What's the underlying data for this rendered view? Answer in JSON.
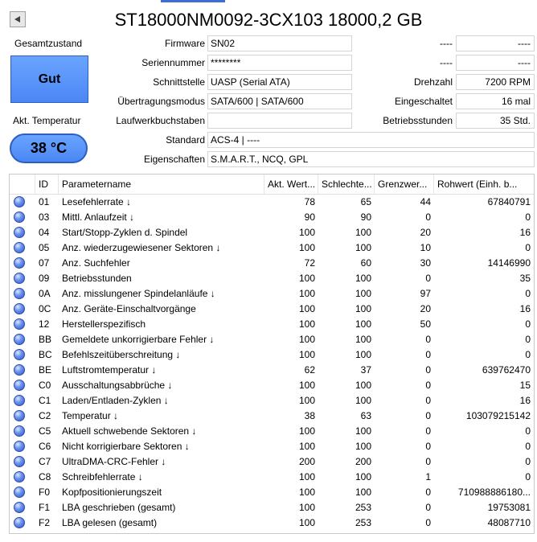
{
  "title": "ST18000NM0092-3CX103 18000,2 GB",
  "health": {
    "label": "Gesamtzustand",
    "value": "Gut",
    "color": "#5a96fa"
  },
  "temperature": {
    "label": "Akt. Temperatur",
    "value": "38 °C"
  },
  "info": {
    "firmware_label": "Firmware",
    "firmware": "SN02",
    "serial_label": "Seriennummer",
    "serial": "********",
    "interface_label": "Schnittstelle",
    "interface": "UASP (Serial ATA)",
    "transfer_label": "Übertragungsmodus",
    "transfer": "SATA/600 | SATA/600",
    "drive_letter_label": "Laufwerkbuchstaben",
    "drive_letter": "",
    "standard_label": "Standard",
    "standard": "ACS-4 | ----",
    "features_label": "Eigenschaften",
    "features": "S.M.A.R.T., NCQ, GPL",
    "right_top1_label": "----",
    "right_top1": "----",
    "right_top2_label": "----",
    "right_top2": "----",
    "rpm_label": "Drehzahl",
    "rpm": "7200 RPM",
    "power_count_label": "Eingeschaltet",
    "power_count": "16 mal",
    "hours_label": "Betriebsstunden",
    "hours": "35 Std."
  },
  "table": {
    "headers": [
      "",
      "ID",
      "Parametername",
      "Akt. Wert...",
      "Schlechte...",
      "Grenzwer...",
      "Rohwert (Einh. b..."
    ],
    "rows": [
      [
        "01",
        "Lesefehlerrate ↓",
        "78",
        "65",
        "44",
        "67840791"
      ],
      [
        "03",
        "Mittl. Anlaufzeit ↓",
        "90",
        "90",
        "0",
        "0"
      ],
      [
        "04",
        "Start/Stopp-Zyklen d. Spindel",
        "100",
        "100",
        "20",
        "16"
      ],
      [
        "05",
        "Anz. wiederzugewiesener Sektoren ↓",
        "100",
        "100",
        "10",
        "0"
      ],
      [
        "07",
        "Anz. Suchfehler",
        "72",
        "60",
        "30",
        "14146990"
      ],
      [
        "09",
        "Betriebsstunden",
        "100",
        "100",
        "0",
        "35"
      ],
      [
        "0A",
        "Anz. misslungener Spindelanläufe ↓",
        "100",
        "100",
        "97",
        "0"
      ],
      [
        "0C",
        "Anz. Geräte-Einschaltvorgänge",
        "100",
        "100",
        "20",
        "16"
      ],
      [
        "12",
        "Herstellerspezifisch",
        "100",
        "100",
        "50",
        "0"
      ],
      [
        "BB",
        "Gemeldete unkorrigierbare Fehler ↓",
        "100",
        "100",
        "0",
        "0"
      ],
      [
        "BC",
        "Befehlszeitüberschreitung ↓",
        "100",
        "100",
        "0",
        "0"
      ],
      [
        "BE",
        "Luftstromtemperatur ↓",
        "62",
        "37",
        "0",
        "639762470"
      ],
      [
        "C0",
        "Ausschaltungsabbrüche ↓",
        "100",
        "100",
        "0",
        "15"
      ],
      [
        "C1",
        "Laden/Entladen-Zyklen ↓",
        "100",
        "100",
        "0",
        "16"
      ],
      [
        "C2",
        "Temperatur ↓",
        "38",
        "63",
        "0",
        "103079215142"
      ],
      [
        "C5",
        "Aktuell schwebende Sektoren ↓",
        "100",
        "100",
        "0",
        "0"
      ],
      [
        "C6",
        "Nicht korrigierbare Sektoren ↓",
        "100",
        "100",
        "0",
        "0"
      ],
      [
        "C7",
        "UltraDMA-CRC-Fehler ↓",
        "200",
        "200",
        "0",
        "0"
      ],
      [
        "C8",
        "Schreibfehlerrate ↓",
        "100",
        "100",
        "1",
        "0"
      ],
      [
        "F0",
        "Kopfpositionierungszeit",
        "100",
        "100",
        "0",
        "710988886180..."
      ],
      [
        "F1",
        "LBA geschrieben (gesamt)",
        "100",
        "253",
        "0",
        "19753081"
      ],
      [
        "F2",
        "LBA gelesen (gesamt)",
        "100",
        "253",
        "0",
        "48087710"
      ]
    ]
  }
}
